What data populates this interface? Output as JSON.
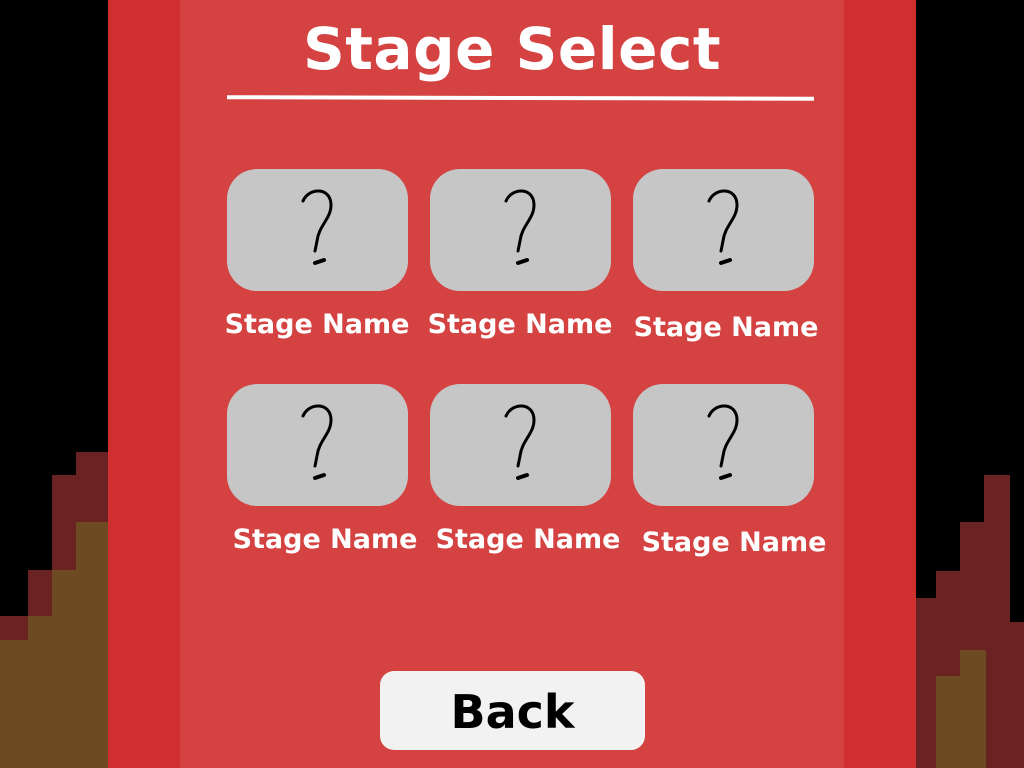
{
  "screen": {
    "title": "Stage Select"
  },
  "stages": [
    {
      "name": "Stage Name",
      "thumbnail_icon": "question-mark"
    },
    {
      "name": "Stage Name",
      "thumbnail_icon": "question-mark"
    },
    {
      "name": "Stage Name",
      "thumbnail_icon": "question-mark"
    },
    {
      "name": "Stage Name",
      "thumbnail_icon": "question-mark"
    },
    {
      "name": "Stage Name",
      "thumbnail_icon": "question-mark"
    },
    {
      "name": "Stage Name",
      "thumbnail_icon": "question-mark"
    }
  ],
  "back_button": {
    "label": "Back"
  },
  "colors": {
    "panel_outer": "#cf2f2f",
    "panel_inner": "#d44241",
    "tile": "#c6c6c6",
    "flame_dark": "#6b2222",
    "flame_light": "#6e4a22",
    "background": "#000000"
  }
}
